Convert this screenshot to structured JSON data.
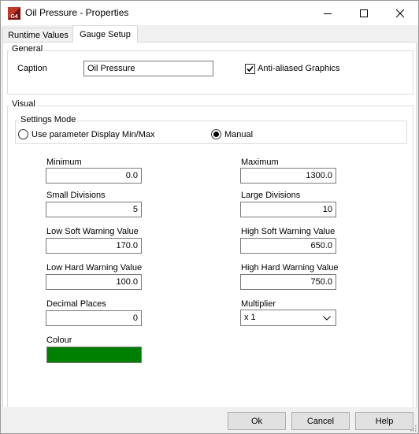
{
  "window": {
    "title": "Oil Pressure - Properties",
    "icon_text": "G4"
  },
  "tabs": [
    {
      "label": "Runtime Values"
    },
    {
      "label": "Gauge Setup"
    }
  ],
  "general": {
    "group_label": "General",
    "caption_label": "Caption",
    "caption_value": "Oil Pressure",
    "antialias_label": "Anti-aliased Graphics",
    "antialias_checked": true
  },
  "visual": {
    "group_label": "Visual",
    "settings_mode": {
      "group_label": "Settings Mode",
      "option_param": "Use parameter Display Min/Max",
      "option_manual": "Manual",
      "selected": "Manual"
    },
    "fields": {
      "minimum": {
        "label": "Minimum",
        "value": "0.0"
      },
      "maximum": {
        "label": "Maximum",
        "value": "1300.0"
      },
      "small_divisions": {
        "label": "Small Divisions",
        "value": "5"
      },
      "large_divisions": {
        "label": "Large Divisions",
        "value": "10"
      },
      "low_soft": {
        "label": "Low Soft Warning Value",
        "value": "170.0"
      },
      "high_soft": {
        "label": "High Soft Warning Value",
        "value": "650.0"
      },
      "low_hard": {
        "label": "Low Hard Warning Value",
        "value": "100.0"
      },
      "high_hard": {
        "label": "High Hard Warning Value",
        "value": "750.0"
      },
      "decimal_places": {
        "label": "Decimal Places",
        "value": "0"
      },
      "multiplier": {
        "label": "Multiplier",
        "value": "x 1"
      }
    },
    "colour": {
      "label": "Colour",
      "value": "#008000"
    }
  },
  "buttons": {
    "ok": "Ok",
    "cancel": "Cancel",
    "help": "Help"
  }
}
